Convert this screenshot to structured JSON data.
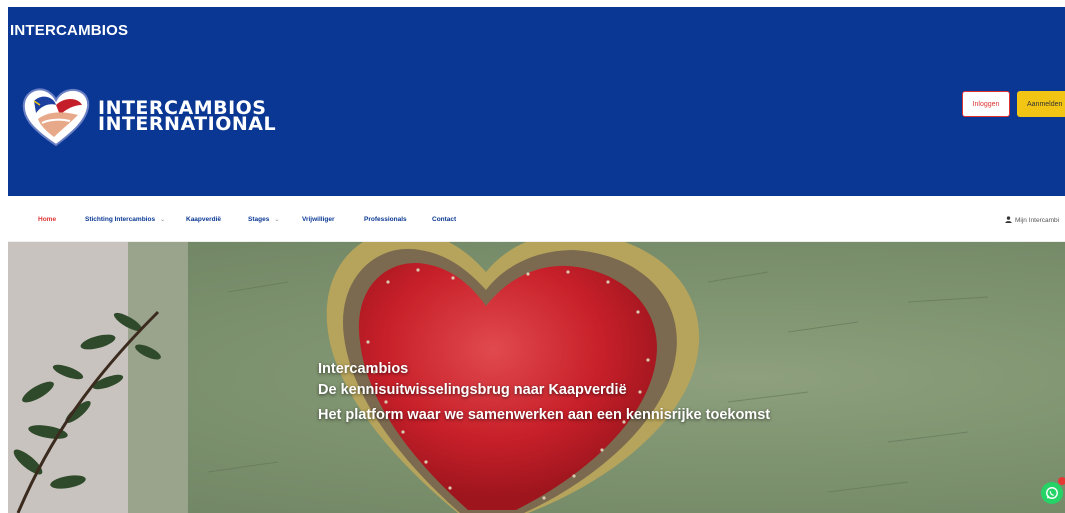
{
  "site": {
    "title": "INTERCAMBIOS"
  },
  "logo": {
    "line1": "INTERCAMBIOS",
    "line2": "INTERNATIONAL"
  },
  "header_buttons": {
    "login": "Inloggen",
    "register": "Aanmelden"
  },
  "nav": {
    "items": [
      {
        "label": "Home",
        "active": true
      },
      {
        "label": "Stichting Intercambios",
        "dropdown": true
      },
      {
        "label": "Kaapverdië"
      },
      {
        "label": "Stages",
        "dropdown": true
      },
      {
        "label": "Vrijwilliger"
      },
      {
        "label": "Professionals"
      },
      {
        "label": "Contact"
      }
    ],
    "account": "Mijn Intercambi"
  },
  "hero": {
    "line1": "Intercambios",
    "line2": "De kennisuitwisselingsbrug naar Kaapverdië",
    "line3": "Het platform waar we samenwerken aan een kennisrijke toekomst"
  },
  "colors": {
    "header_bg": "#0a3793",
    "accent_red": "#dd3333",
    "accent_yellow": "#f2c515",
    "whatsapp": "#25d366"
  },
  "icons": {
    "account": "user-icon",
    "chat": "whatsapp-icon"
  }
}
